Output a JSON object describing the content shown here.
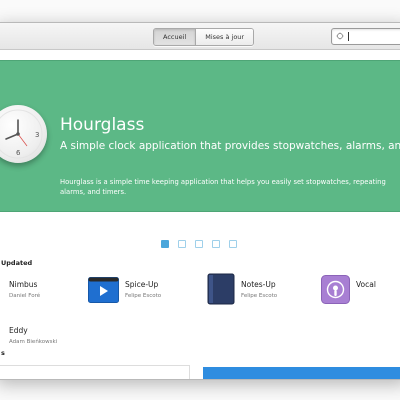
{
  "header": {
    "tabs": [
      {
        "label": "Accueil",
        "active": true
      },
      {
        "label": "Mises à jour",
        "active": false
      }
    ],
    "search": {
      "value": "",
      "placeholder": ""
    }
  },
  "banner": {
    "title": "Hourglass",
    "subtitle": "A simple clock application that provides stopwatches, alarms, and timers.",
    "description": "Hourglass is a simple time keeping application that helps you easily set stopwatches, repeating alarms, and timers.",
    "background": "#5cb886",
    "icon": "clock-icon"
  },
  "carousel": {
    "count": 5,
    "active_index": 0,
    "accent": "#4aa6db"
  },
  "recent": {
    "title": "Updated",
    "apps": [
      {
        "name": "Nimbus",
        "author": "Daniel Foré",
        "icon": "nimbus-icon"
      },
      {
        "name": "Spice-Up",
        "author": "Felipe Escoto",
        "icon": "spice-up-icon"
      },
      {
        "name": "Notes-Up",
        "author": "Felipe Escoto",
        "icon": "notes-up-icon"
      },
      {
        "name": "Vocal",
        "author": "",
        "icon": "vocal-icon"
      },
      {
        "name": "Eddy",
        "author": "Adam Bieńkowski",
        "icon": ""
      }
    ]
  },
  "section2": {
    "title": "s"
  },
  "colors": {
    "accent_blue": "#2f8de0",
    "vocal_purple": "#a87fd3"
  }
}
